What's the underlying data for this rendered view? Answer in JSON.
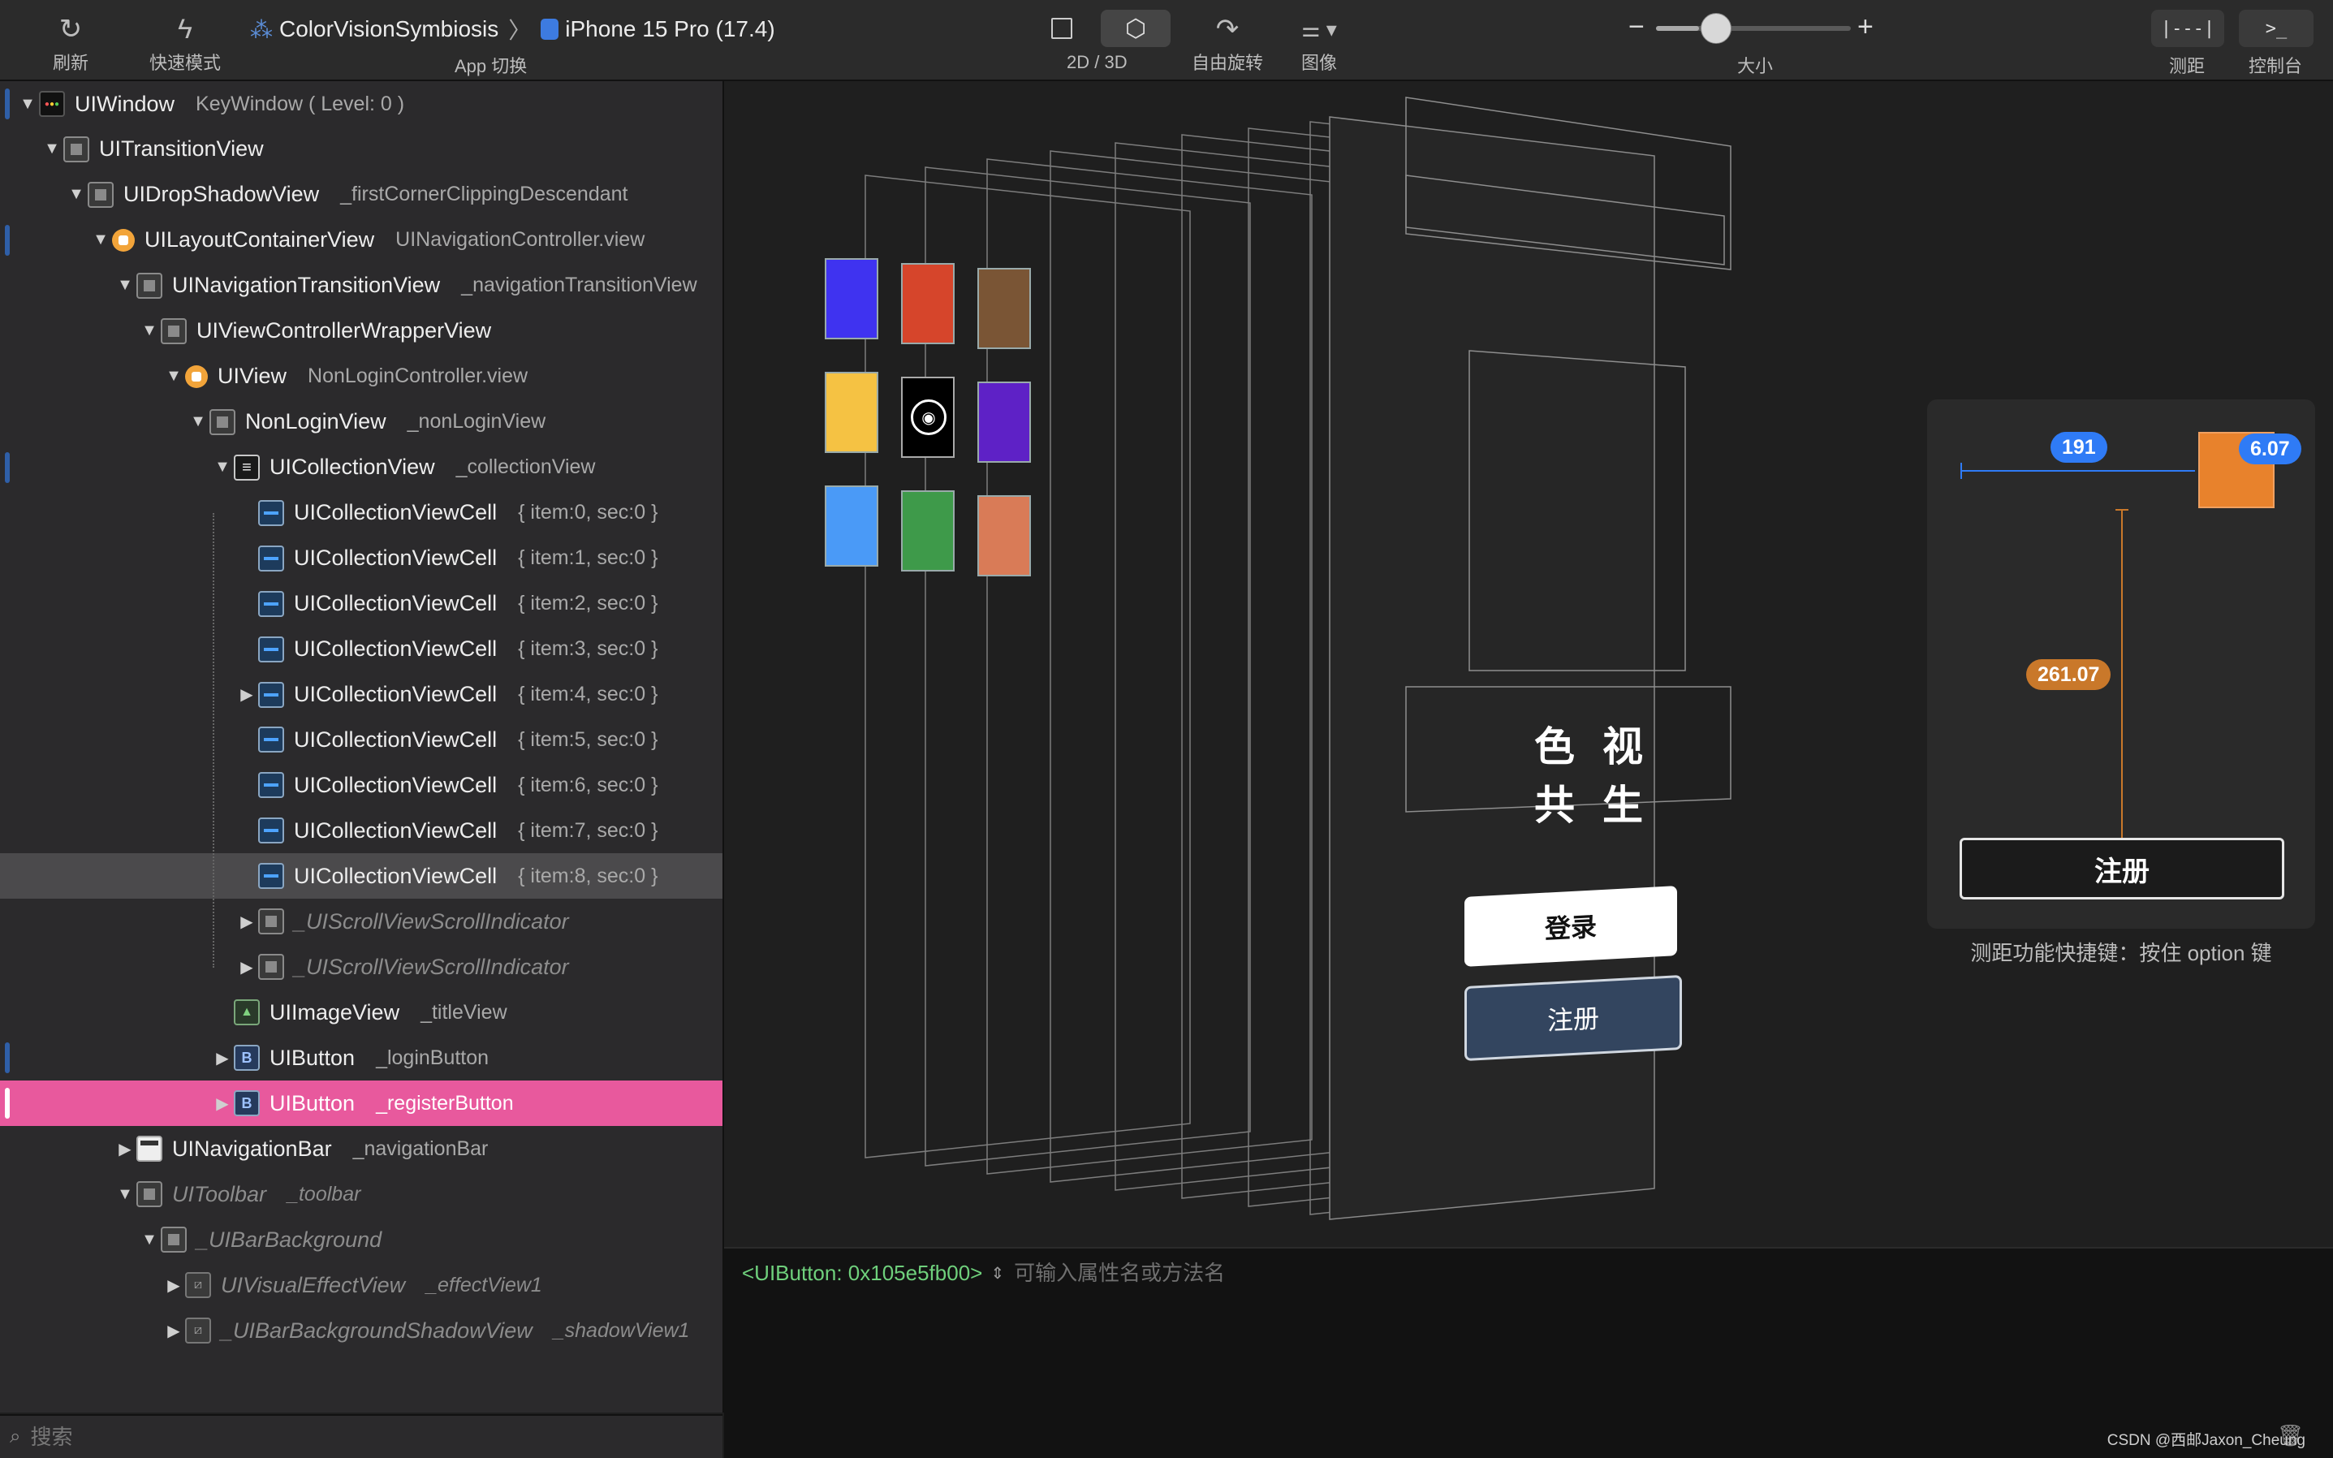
{
  "toolbar": {
    "refresh": "刷新",
    "fast_mode": "快速模式",
    "app_name": "ColorVisionSymbiosis",
    "separator": "〉",
    "device": "iPhone 15 Pro (17.4)",
    "app_switch": "App 切换",
    "mode_2d3d": "2D / 3D",
    "free_rotate": "自由旋转",
    "image": "图像",
    "size": "大小",
    "size_minus": "−",
    "size_plus": "+",
    "size_level": 0.22,
    "measure": "测距",
    "measure_glyph": "|---|",
    "console": "控制台",
    "console_glyph": ">_"
  },
  "tree": [
    {
      "cls": "UIWindow",
      "ann": "KeyWindow ( Level: 0 )",
      "depth": 0,
      "disc": "▼",
      "icon": "win",
      "mark": true
    },
    {
      "cls": "UITransitionView",
      "ann": "",
      "depth": 1,
      "disc": "▼",
      "icon": "sq"
    },
    {
      "cls": "UIDropShadowView",
      "ann": "_firstCornerClippingDescendant",
      "depth": 2,
      "disc": "▼",
      "icon": "sq"
    },
    {
      "cls": "UILayoutContainerView",
      "ann": "UINavigationController.view",
      "depth": 3,
      "disc": "▼",
      "icon": "orange",
      "mark": true
    },
    {
      "cls": "UINavigationTransitionView",
      "ann": "_navigationTransitionView",
      "depth": 4,
      "disc": "▼",
      "icon": "sq"
    },
    {
      "cls": "UIViewControllerWrapperView",
      "ann": "",
      "depth": 5,
      "disc": "▼",
      "icon": "sq"
    },
    {
      "cls": "UIView",
      "ann": "NonLoginController.view",
      "depth": 6,
      "disc": "▼",
      "icon": "orange"
    },
    {
      "cls": "NonLoginView",
      "ann": "_nonLoginView",
      "depth": 7,
      "disc": "▼",
      "icon": "sq"
    },
    {
      "cls": "UICollectionView",
      "ann": "_collectionView",
      "depth": 8,
      "disc": "▼",
      "icon": "coll",
      "mark": true
    },
    {
      "cls": "UICollectionViewCell",
      "ann": "{ item:0, sec:0 }",
      "depth": 9,
      "disc": "",
      "icon": "cell"
    },
    {
      "cls": "UICollectionViewCell",
      "ann": "{ item:1, sec:0 }",
      "depth": 9,
      "disc": "",
      "icon": "cell"
    },
    {
      "cls": "UICollectionViewCell",
      "ann": "{ item:2, sec:0 }",
      "depth": 9,
      "disc": "",
      "icon": "cell"
    },
    {
      "cls": "UICollectionViewCell",
      "ann": "{ item:3, sec:0 }",
      "depth": 9,
      "disc": "",
      "icon": "cell"
    },
    {
      "cls": "UICollectionViewCell",
      "ann": "{ item:4, sec:0 }",
      "depth": 9,
      "disc": "▶",
      "icon": "cell"
    },
    {
      "cls": "UICollectionViewCell",
      "ann": "{ item:5, sec:0 }",
      "depth": 9,
      "disc": "",
      "icon": "cell"
    },
    {
      "cls": "UICollectionViewCell",
      "ann": "{ item:6, sec:0 }",
      "depth": 9,
      "disc": "",
      "icon": "cell"
    },
    {
      "cls": "UICollectionViewCell",
      "ann": "{ item:7, sec:0 }",
      "depth": 9,
      "disc": "",
      "icon": "cell"
    },
    {
      "cls": "UICollectionViewCell",
      "ann": "{ item:8, sec:0 }",
      "depth": 9,
      "disc": "",
      "icon": "cell",
      "sel": "grey"
    },
    {
      "cls": "_UIScrollViewScrollIndicator",
      "ann": "",
      "depth": 9,
      "disc": "▶",
      "icon": "sq",
      "dim": true
    },
    {
      "cls": "_UIScrollViewScrollIndicator",
      "ann": "",
      "depth": 9,
      "disc": "▶",
      "icon": "sq",
      "dim": true
    },
    {
      "cls": "UIImageView",
      "ann": "_titleView",
      "depth": 8,
      "disc": "",
      "icon": "img"
    },
    {
      "cls": "UIButton",
      "ann": "_loginButton",
      "depth": 8,
      "disc": "▶",
      "icon": "btn",
      "mark": true
    },
    {
      "cls": "UIButton",
      "ann": "_registerButton",
      "depth": 8,
      "disc": "▶",
      "icon": "btn",
      "sel": "pink",
      "mark": true
    },
    {
      "cls": "UINavigationBar",
      "ann": "_navigationBar",
      "depth": 4,
      "disc": "▶",
      "icon": "bar"
    },
    {
      "cls": "UIToolbar",
      "ann": "_toolbar",
      "depth": 4,
      "disc": "▼",
      "icon": "sq",
      "dim": true
    },
    {
      "cls": "_UIBarBackground",
      "ann": "",
      "depth": 5,
      "disc": "▼",
      "icon": "sq",
      "dim": true
    },
    {
      "cls": "UIVisualEffectView",
      "ann": "_effectView1",
      "depth": 6,
      "disc": "▶",
      "icon": "stripe",
      "dim": true
    },
    {
      "cls": "_UIBarBackgroundShadowView",
      "ann": "_shadowView1",
      "depth": 6,
      "disc": "▶",
      "icon": "stripe",
      "dim": true
    }
  ],
  "search": {
    "placeholder": "搜索"
  },
  "canvas": {
    "swatches": [
      "#3f33f0",
      "#d6452b",
      "#7a5535",
      "#f5c243",
      "#000000",
      "#5e21c6",
      "#4a9af7",
      "#3e9a4a",
      "#d97b57"
    ],
    "title_text": "色 视 共 生",
    "login_label": "登录",
    "register_label": "注册"
  },
  "measure": {
    "horizontal": "191",
    "right": "6.07",
    "vertical": "261.07",
    "target_label": "注册",
    "swatch_color": "#e8822c",
    "hint": "测距功能快捷键：按住 option 键"
  },
  "console": {
    "target": "<UIButton: 0x105e5fb00>",
    "placeholder": "可输入属性名或方法名"
  },
  "watermark": "CSDN @西邮Jaxon_Cheung"
}
